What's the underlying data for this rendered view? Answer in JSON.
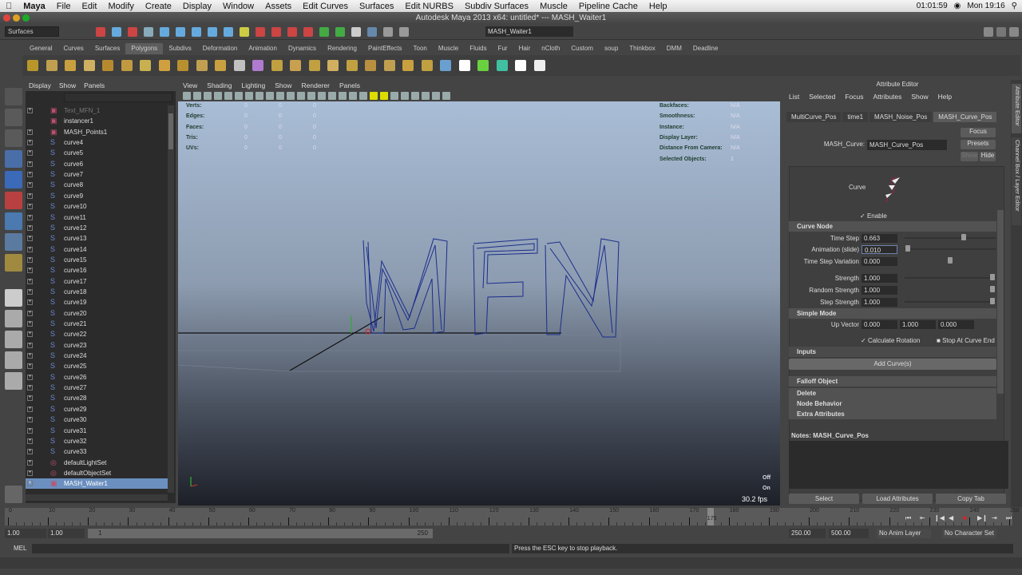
{
  "mac_menu": {
    "app": "Maya",
    "items": [
      "File",
      "Edit",
      "Modify",
      "Create",
      "Display",
      "Window",
      "Assets",
      "Edit Curves",
      "Surfaces",
      "Edit NURBS",
      "Subdiv Surfaces",
      "Muscle",
      "Pipeline Cache",
      "Help"
    ],
    "clock": "Mon 19:16",
    "timer": "01:01:59"
  },
  "window_title": "Autodesk Maya 2013 x64: untitled*  ---  MASH_Waiter1",
  "status_line": {
    "menu_set": "Surfaces",
    "name_field": "MASH_Waiter1"
  },
  "shelf_tabs": [
    "General",
    "Curves",
    "Surfaces",
    "Polygons",
    "Subdivs",
    "Deformation",
    "Animation",
    "Dynamics",
    "Rendering",
    "PaintEffects",
    "Toon",
    "Muscle",
    "Fluids",
    "Fur",
    "Hair",
    "nCloth",
    "Custom",
    "soup",
    "Thinkbox",
    "DMM",
    "Deadline"
  ],
  "shelf_active": "Polygons",
  "outliner": {
    "menu": [
      "Display",
      "Show",
      "Panels"
    ],
    "items": [
      "Text_MFN_1",
      "instancer1",
      "MASH_Points1",
      "curve4",
      "curve5",
      "curve6",
      "curve7",
      "curve8",
      "curve9",
      "curve10",
      "curve11",
      "curve12",
      "curve13",
      "curve14",
      "curve15",
      "curve16",
      "curve17",
      "curve18",
      "curve19",
      "curve20",
      "curve21",
      "curve22",
      "curve23",
      "curve24",
      "curve25",
      "curve26",
      "curve27",
      "curve28",
      "curve29",
      "curve30",
      "curve31",
      "curve32",
      "curve33",
      "defaultLightSet",
      "defaultObjectSet",
      "MASH_Waiter1"
    ],
    "selected": "MASH_Waiter1"
  },
  "viewport": {
    "menu": [
      "View",
      "Shading",
      "Lighting",
      "Show",
      "Renderer",
      "Panels"
    ],
    "hud_left": [
      {
        "label": "Verts:",
        "v": [
          "0",
          "0",
          "0"
        ]
      },
      {
        "label": "Edges:",
        "v": [
          "0",
          "0",
          "0"
        ]
      },
      {
        "label": "Faces:",
        "v": [
          "0",
          "0",
          "0"
        ]
      },
      {
        "label": "Tris:",
        "v": [
          "0",
          "0",
          "0"
        ]
      },
      {
        "label": "UVs:",
        "v": [
          "0",
          "0",
          "0"
        ]
      }
    ],
    "hud_right": [
      {
        "label": "Backfaces:",
        "v": "N/A"
      },
      {
        "label": "Smoothness:",
        "v": "N/A"
      },
      {
        "label": "Instance:",
        "v": "N/A"
      },
      {
        "label": "Display Layer:",
        "v": "N/A"
      },
      {
        "label": "Distance From Camera:",
        "v": "N/A"
      },
      {
        "label": "Selected Objects:",
        "v": "1"
      }
    ],
    "hud_bottom": {
      "off": "Off",
      "on": "On",
      "fps": "30.2 fps"
    }
  },
  "attribute_editor": {
    "title": "Attribute Editor",
    "menu": [
      "List",
      "Selected",
      "Focus",
      "Attributes",
      "Show",
      "Help"
    ],
    "tabs": [
      "MultiCurve_Pos",
      "time1",
      "MASH_Noise_Pos",
      "MASH_Curve_Pos"
    ],
    "node_label": "MASH_Curve:",
    "node_value": "MASH_Curve_Pos",
    "focus": "Focus",
    "presets": "Presets",
    "show": "Show",
    "hide": "Hide",
    "curve_label": "Curve",
    "enable": "Enable",
    "curve_node": "Curve Node",
    "time_step": {
      "label": "Time Step",
      "value": "0.663",
      "fraction": 0.66
    },
    "animation_slide": {
      "label": "Animation (slide)",
      "value": "0.010",
      "fraction": 0.01
    },
    "time_step_variation": {
      "label": "Time Step Variation",
      "value": "0.000",
      "fraction": 0.5
    },
    "strength": {
      "label": "Strength",
      "value": "1.000"
    },
    "random_strength": {
      "label": "Random Strength",
      "value": "1.000"
    },
    "step_strength": {
      "label": "Step Strength",
      "value": "1.000"
    },
    "simple_mode": "Simple Mode",
    "up_vector": {
      "label": "Up Vector",
      "x": "0.000",
      "y": "1.000",
      "z": "0.000"
    },
    "calc_rotation": "Calculate Rotation",
    "stop_at_end": "Stop At Curve End",
    "inputs": "Inputs",
    "add_curves": "Add Curve(s)",
    "sections": [
      "Falloff Object",
      "Delete",
      "Node Behavior",
      "Extra Attributes"
    ],
    "notes": "Notes:  MASH_Curve_Pos",
    "buttons": [
      "Select",
      "Load Attributes",
      "Copy Tab"
    ]
  },
  "side_tabs": [
    "Attribute Editor",
    "Channel Box / Layer Editor"
  ],
  "timeline": {
    "start": 0,
    "end": 250,
    "step": 10,
    "current": "175"
  },
  "range": {
    "start": "1.00",
    "play_start": "1.00",
    "slider_min": "1",
    "slider_max": "250",
    "play_end": "250.00",
    "end": "500.00",
    "anim_layer": "No Anim Layer",
    "char_set": "No Character Set"
  },
  "command": {
    "label": "MEL",
    "message": "Press the ESC key to stop playback."
  },
  "letters": "MFN"
}
